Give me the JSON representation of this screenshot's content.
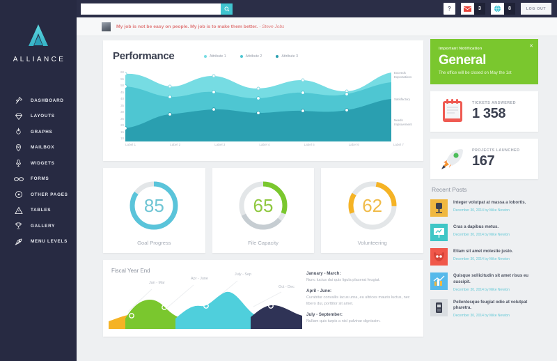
{
  "brand": {
    "name": "ALLIANCE",
    "logo_icon": "alliance-triangle-logo"
  },
  "sidebar": {
    "items": [
      {
        "label": "DASHBOARD",
        "icon": "dashboard-pin-icon"
      },
      {
        "label": "LAYOUTS",
        "icon": "diamond-icon"
      },
      {
        "label": "GRAPHS",
        "icon": "flame-icon"
      },
      {
        "label": "MAILBOX",
        "icon": "location-pin-icon"
      },
      {
        "label": "WIDGETS",
        "icon": "microphone-icon"
      },
      {
        "label": "FORMS",
        "icon": "glasses-icon"
      },
      {
        "label": "OTHER PAGES",
        "icon": "circle-dot-icon"
      },
      {
        "label": "TABLES",
        "icon": "triangle-alert-icon"
      },
      {
        "label": "GALLERY",
        "icon": "trophy-icon"
      },
      {
        "label": "MENU LEVELS",
        "icon": "feather-icon"
      }
    ]
  },
  "topbar": {
    "search_placeholder": "",
    "search_value": "",
    "search_icon": "search-icon",
    "help_label": "?",
    "mail_icon": "envelope-icon",
    "mail_count": "3",
    "globe_icon": "globe-icon",
    "globe_count": "8",
    "logout_label": "LOG OUT"
  },
  "quote": {
    "avatar_icon": "user-avatar",
    "text": "My job is not be easy on people. My job is to make them better.",
    "author": "- Steve Jobs"
  },
  "chart_data": [
    {
      "type": "area",
      "title": "Performance",
      "xlabel": "",
      "ylabel": "",
      "ylim": [
        10,
        60
      ],
      "grid": false,
      "legend_position": "top",
      "tick_labels_y": [
        "60",
        "55",
        "50",
        "45",
        "40",
        "35",
        "30",
        "25",
        "20",
        "15",
        "10"
      ],
      "categories": [
        "Label 1",
        "Label 2",
        "Label 3",
        "Label 4",
        "Label 5",
        "Label 6",
        "Label 7"
      ],
      "series": [
        {
          "name": "Attribute 1",
          "color": "#76dce3",
          "values": [
            60,
            54,
            57,
            53,
            54,
            57,
            62
          ]
        },
        {
          "name": "Attribute 2",
          "color": "#4ec6d2",
          "values": [
            50,
            45,
            48,
            44,
            46,
            44,
            52
          ]
        },
        {
          "name": "Attribute 3",
          "color": "#2a9fb0",
          "values": [
            20,
            28,
            30,
            33,
            33,
            30,
            40
          ]
        }
      ],
      "annotations": [
        "Exceeds Expectations",
        "Satisfactory",
        "Needs Improvement"
      ]
    },
    {
      "type": "area",
      "title": "Fiscal Year End",
      "categories": [
        "Jan - Mar",
        "Apr - June",
        "July - Sep",
        "Oct - Dec"
      ],
      "series": [
        {
          "name": "Jan - Mar",
          "color": "#f5b325",
          "values": [
            30
          ]
        },
        {
          "name": "Apr - June",
          "color": "#7ac72e",
          "values": [
            58
          ]
        },
        {
          "name": "July - Sep",
          "color": "#4fcfdc",
          "values": [
            75
          ]
        },
        {
          "name": "Oct - Dec",
          "color": "#2f3356",
          "values": [
            48
          ]
        }
      ]
    },
    {
      "type": "pie",
      "title": "Goal Progress",
      "value": 85,
      "max": 100,
      "color": "#5ac4da"
    },
    {
      "type": "pie",
      "title": "File Capacity",
      "value": 65,
      "max": 100,
      "color": "#7ac72e"
    },
    {
      "type": "pie",
      "title": "Volunteering",
      "value": 62,
      "max": 100,
      "color": "#f5b325"
    }
  ],
  "performance": {
    "title": "Performance",
    "legend": [
      {
        "label": "Attribute 1",
        "color": "#76dce3"
      },
      {
        "label": "Attribute 2",
        "color": "#4ec6d2"
      },
      {
        "label": "Attribute 3",
        "color": "#2a9fb0"
      }
    ],
    "y_ticks": [
      "60",
      "55",
      "50",
      "45",
      "40",
      "35",
      "30",
      "25",
      "20",
      "15",
      "10"
    ],
    "x_labels": [
      "Label 1",
      "Label 2",
      "Label 3",
      "Label 4",
      "Label 5",
      "Label 6",
      "Label 7"
    ],
    "annotations": [
      {
        "line1": "Exceeds",
        "line2": "Expectations"
      },
      {
        "line1": "Satisfactory",
        "line2": ""
      },
      {
        "line1": "Needs",
        "line2": "Improvement"
      }
    ]
  },
  "gauges": [
    {
      "value": "85",
      "label": "Goal Progress",
      "color": "#5ac4da",
      "pct": 85
    },
    {
      "value": "65",
      "label": "File Capacity",
      "color": "#7ac72e",
      "pct": 65
    },
    {
      "value": "62",
      "label": "Volunteering",
      "color": "#f5b325",
      "pct": 62
    }
  ],
  "fiscal": {
    "title": "Fiscal Year End",
    "labels": [
      "Jan - Mar",
      "Apr - June",
      "July - Sep",
      "Oct - Dec"
    ],
    "blocks": [
      {
        "heading": "January - March:",
        "body": "Nunc luctus dui quis ligula placerat feugiat."
      },
      {
        "heading": "April - June:",
        "body": "Curabitur convallis lacus urna, eu ultrices mauris luctus, nec libero dui, porttitor sit amet."
      },
      {
        "heading": "July - September:",
        "body": "Nullam quis turpis a nisl pulvinar dignissim."
      }
    ]
  },
  "notification": {
    "kicker": "Important Notification",
    "title": "General",
    "body": "The office will be closed on May the 1st",
    "close_icon": "close-icon",
    "color": "#7ac72e"
  },
  "stats": [
    {
      "key": "TICKETS ANSWERED",
      "value": "1 358",
      "icon": "notepad-icon"
    },
    {
      "key": "PROJECTS LAUNCHED",
      "value": "167",
      "icon": "rocket-icon"
    }
  ],
  "recent_posts": {
    "title": "Recent Posts",
    "items": [
      {
        "title": "Integer volutpat at massa a lobortis.",
        "meta": "December 30, 2014 by Mike Newton",
        "thumb_color": "#f0b840",
        "thumb_icon": "office-chair-icon"
      },
      {
        "title": "Cras a dapibus metus.",
        "meta": "December 30, 2014 by Mike Newton",
        "thumb_color": "#3fc6c6",
        "thumb_icon": "presentation-icon"
      },
      {
        "title": "Etiam sit amet molestie justo.",
        "meta": "December 30, 2014 by Mike Newton",
        "thumb_color": "#f0584a",
        "thumb_icon": "mask-icon"
      },
      {
        "title": "Quisque sollicitudin sit amet risus eu suscipit.",
        "meta": "December 30, 2014 by Mike Newton",
        "thumb_color": "#56b9ea",
        "thumb_icon": "bar-chart-icon"
      },
      {
        "title": "Pellentesque feugiat odio at volutpat pharetra.",
        "meta": "December 30, 2014 by Mike Newton",
        "thumb_color": "#d9dde1",
        "thumb_icon": "id-badge-icon"
      }
    ]
  }
}
